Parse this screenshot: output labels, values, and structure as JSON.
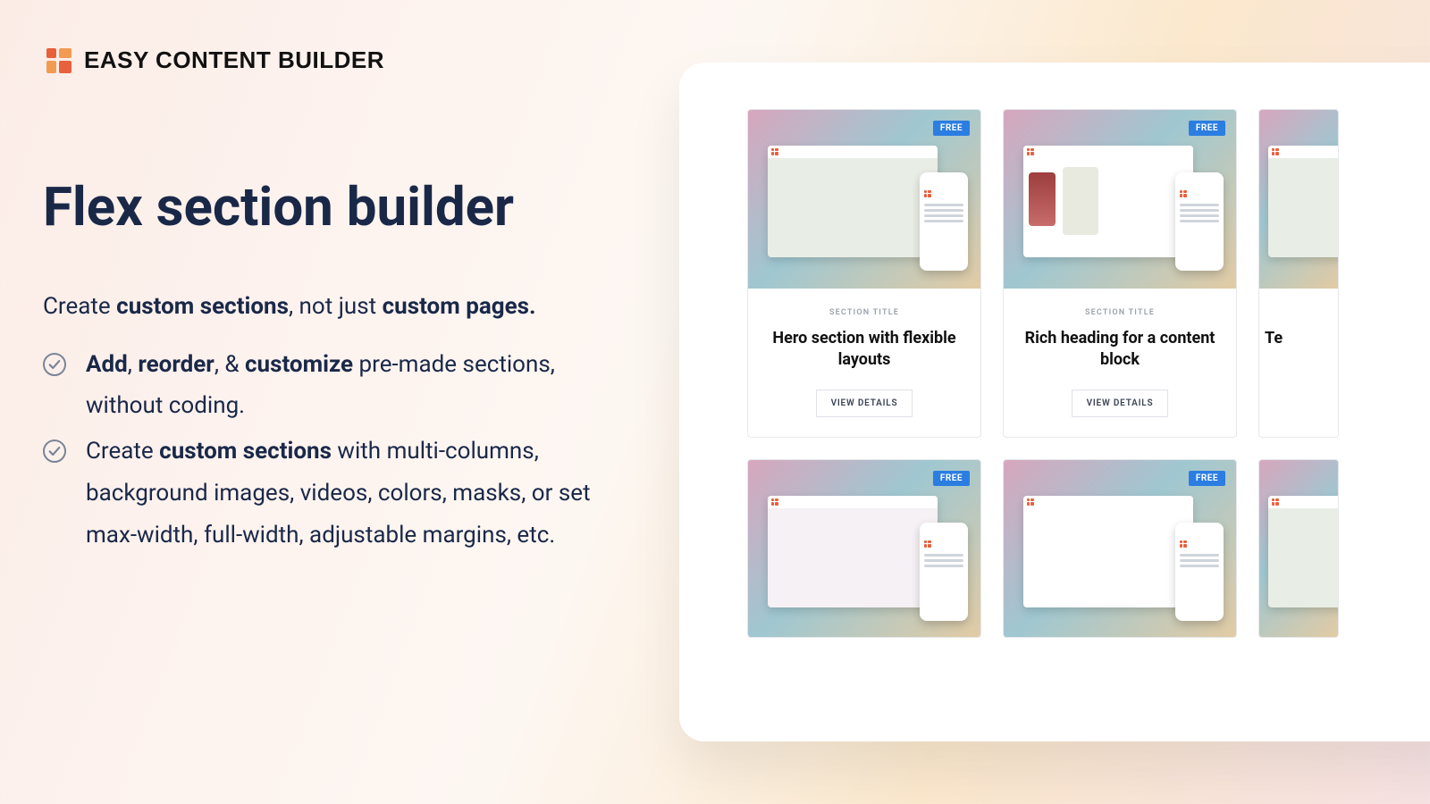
{
  "brand": {
    "name": "EASY CONTENT BUILDER"
  },
  "hero": {
    "title": "Flex section builder",
    "lead_pre": "Create ",
    "lead_b1": "custom sections",
    "lead_mid": ", not just ",
    "lead_b2": "custom pages.",
    "bullet1": {
      "b1": "Add",
      "s1": ", ",
      "b2": "reorder",
      "s2": ", & ",
      "b3": "customize",
      "rest": " pre-made sections, without coding."
    },
    "bullet2": {
      "pre": "Create ",
      "b1": "custom sections",
      "rest": " with multi-columns, background images, videos, colors, masks, or set max-width, full-width, adjustable margins, etc."
    }
  },
  "showcase": {
    "badge": "FREE",
    "section_label": "SECTION TITLE",
    "view_details": "VIEW DETAILS",
    "cards_top": [
      {
        "title": "Hero section with flexible layouts"
      },
      {
        "title": "Rich heading for a content block"
      },
      {
        "title": "Te"
      }
    ]
  }
}
